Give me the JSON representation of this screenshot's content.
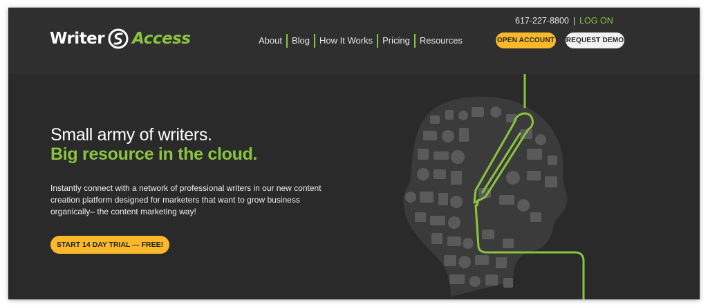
{
  "brand": {
    "name_part1": "Writer",
    "name_part2": "Access",
    "accent_color": "#8bc53f",
    "cta_color": "#f9b92b",
    "background_color": "#2b2b2b"
  },
  "nav": {
    "items": [
      {
        "label": "About"
      },
      {
        "label": "Blog"
      },
      {
        "label": "How It Works"
      },
      {
        "label": "Pricing"
      },
      {
        "label": "Resources"
      }
    ]
  },
  "utility": {
    "phone": "617-227-8800",
    "separator": "|",
    "login_label": "LOG ON",
    "open_account_label": "OPEN ACCOUNT",
    "request_demo_label": "REQUEST DEMO"
  },
  "hero": {
    "headline_line1": "Small army of writers.",
    "headline_line2": "Big resource in the cloud.",
    "description": "Instantly connect with a network of professional writers in our new content creation platform designed for marketers that want to grow business organically– the content marketing way!",
    "cta_label": "START 14 DAY TRIAL — FREE!"
  },
  "icons": {
    "logo_mark": "writeraccess-swirl-icon",
    "illustration": "head-silhouette-with-pen-illustration"
  }
}
